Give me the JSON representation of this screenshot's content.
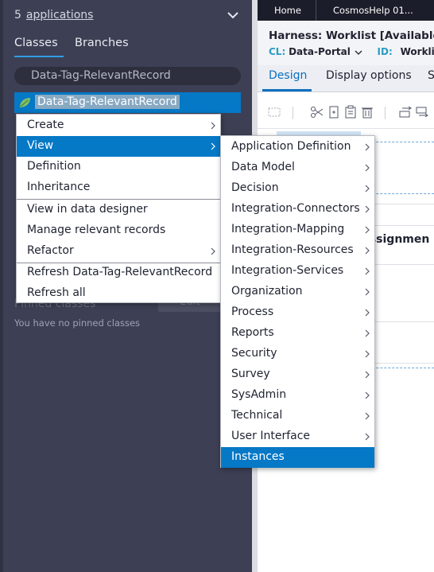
{
  "explorer": {
    "app_count": "5",
    "apps_link": "applications",
    "tabs": [
      "Classes",
      "Branches"
    ],
    "search_value": "Data-Tag-RelevantRecord",
    "selected_class": "Data-Tag-RelevantRecord",
    "pinned_title": "Pinned classes",
    "edit_label": "Edit",
    "no_pinned": "You have no pinned classes"
  },
  "portal": {
    "tabs": [
      "Home",
      "CosmosHelp 01..."
    ]
  },
  "rule": {
    "title": "Harness: Worklist [Available,",
    "cl_key": "CL:",
    "cl_value": "Data-Portal",
    "id_key": "ID:",
    "id_value": "Worklis",
    "tabs": [
      "Design",
      "Display options",
      "S"
    ],
    "column_header": "Assignmen"
  },
  "context_menu": {
    "items": [
      {
        "label": "Create",
        "has_submenu": true
      },
      {
        "label": "View",
        "has_submenu": true,
        "active": true
      },
      {
        "label": "Definition",
        "has_submenu": false
      },
      {
        "label": "Inheritance",
        "has_submenu": false
      },
      {
        "label": "View in data designer",
        "has_submenu": false
      },
      {
        "label": "Manage relevant records",
        "has_submenu": false
      },
      {
        "label": "Refactor",
        "has_submenu": true
      },
      {
        "label": "Refresh Data-Tag-RelevantRecord",
        "has_submenu": false
      },
      {
        "label": "Refresh all",
        "has_submenu": false
      }
    ]
  },
  "view_submenu": {
    "items": [
      {
        "label": "Application Definition",
        "has_submenu": true
      },
      {
        "label": "Data Model",
        "has_submenu": true
      },
      {
        "label": "Decision",
        "has_submenu": true
      },
      {
        "label": "Integration-Connectors",
        "has_submenu": true
      },
      {
        "label": "Integration-Mapping",
        "has_submenu": true
      },
      {
        "label": "Integration-Resources",
        "has_submenu": true
      },
      {
        "label": "Integration-Services",
        "has_submenu": true
      },
      {
        "label": "Organization",
        "has_submenu": true
      },
      {
        "label": "Process",
        "has_submenu": true
      },
      {
        "label": "Reports",
        "has_submenu": true
      },
      {
        "label": "Security",
        "has_submenu": true
      },
      {
        "label": "Survey",
        "has_submenu": true
      },
      {
        "label": "SysAdmin",
        "has_submenu": true
      },
      {
        "label": "Technical",
        "has_submenu": true
      },
      {
        "label": "User Interface",
        "has_submenu": true
      },
      {
        "label": "Instances",
        "has_submenu": false,
        "active": true
      }
    ]
  },
  "colors": {
    "panel_bg": "#3d4054",
    "selection": "#0578c6",
    "tab_accent": "#2f9ee8",
    "portal_bar": "#1b1d2a"
  }
}
